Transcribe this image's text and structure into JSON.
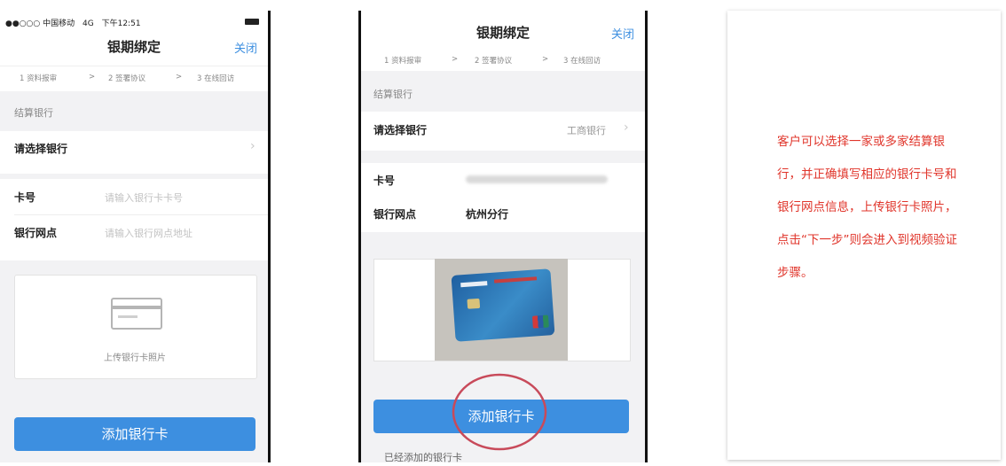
{
  "phone1": {
    "status_bar": {
      "signal": "●●○○○",
      "carrier": "中国移动",
      "network": "4G",
      "time": "下午12:51"
    },
    "nav_title": "银期绑定",
    "close_label": "关闭",
    "steps": [
      "1 资料报审",
      ">",
      "2 签署协议",
      ">",
      "3 在线回访"
    ],
    "section_title": "结算银行",
    "select_bank_label": "请选择银行",
    "card_no_label": "卡号",
    "card_no_placeholder": "请输入银行卡卡号",
    "branch_label": "银行网点",
    "branch_placeholder": "请输入银行网点地址",
    "upload_label": "上传银行卡照片",
    "add_card_button": "添加银行卡"
  },
  "phone2": {
    "nav_title": "银期绑定",
    "close_label": "关闭",
    "steps": [
      "1 资料报审",
      ">",
      "2 签署协议",
      ">",
      "3 在线回访"
    ],
    "section_title": "结算银行",
    "select_bank_label": "请选择银行",
    "selected_bank": "工商银行",
    "card_no_label": "卡号",
    "branch_label": "银行网点",
    "branch_value": "杭州分行",
    "add_card_button": "添加银行卡",
    "added_cards_label": "已经添加的银行卡"
  },
  "note": {
    "text": "客户可以选择一家或多家结算银行，并正确填写相应的银行卡号和银行网点信息，上传银行卡照片，点击“下一步”则会进入到视频验证步骤。"
  },
  "colors": {
    "accent": "#3d8fe0",
    "note_text": "#e0352b",
    "highlight_circle": "#c84a5a"
  }
}
